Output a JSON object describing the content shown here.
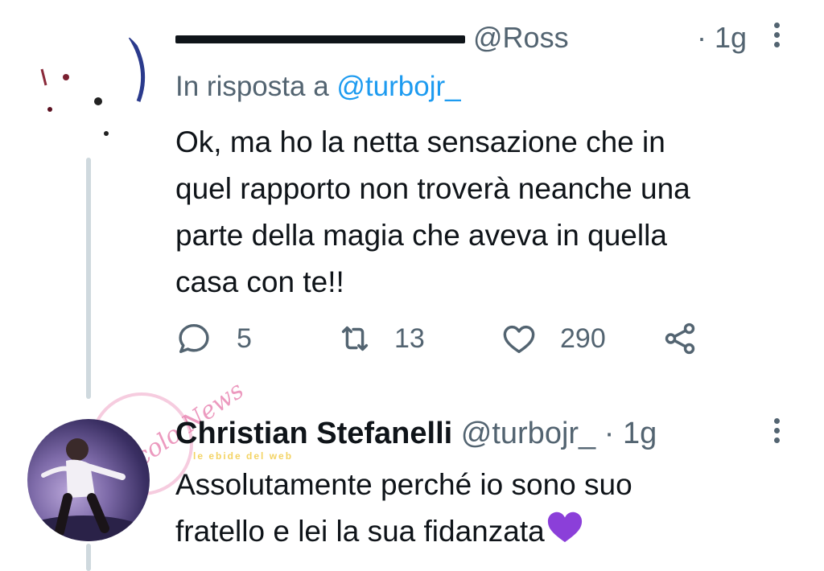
{
  "tweet1": {
    "header_visible": "@Ross",
    "time": "1g",
    "reply_prefix": "In risposta a",
    "reply_handle": "@turbojr_",
    "text_lines": [
      "Ok, ma ho la netta sensazione che in",
      "quel rapporto non troverà neanche una",
      "parte della magia che aveva in quella",
      "casa con te!!"
    ],
    "actions": {
      "reply_count": "5",
      "retweet_count": "13",
      "like_count": "290"
    },
    "icons": [
      "reply-icon",
      "retweet-icon",
      "like-icon",
      "share-icon",
      "more-options-icon"
    ]
  },
  "tweet2": {
    "author_name": "Christian Stefanelli",
    "handle": "@turbojr_",
    "separator": "·",
    "time": "1g",
    "text_lines": [
      "Assolutamente perché io sono suo",
      "fratello e lei la sua fidanzata"
    ],
    "emoji": "purple-heart"
  },
  "watermark": {
    "text": "Nicolo News",
    "sticker_text": "le ebide del web"
  },
  "colors": {
    "primary_text": "#0f1419",
    "secondary_text": "#536471",
    "link_blue": "#1d9bf0",
    "thread_line": "#cfd9de",
    "purple_heart": "#8b3fd9"
  }
}
